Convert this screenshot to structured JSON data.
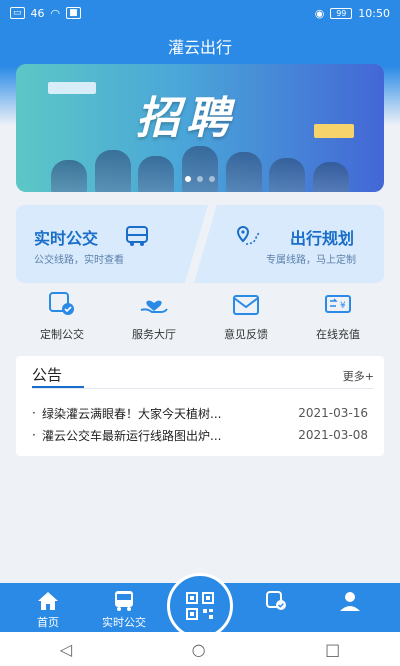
{
  "status": {
    "signal": "46",
    "time": "10:50",
    "battery": "99"
  },
  "app": {
    "title": "灌云出行"
  },
  "banner": {
    "title": "招聘"
  },
  "cards": {
    "bus": {
      "title": "实时公交",
      "subtitle": "公交线路，实时查看"
    },
    "plan": {
      "title": "出行规划",
      "subtitle": "专属线路，马上定制"
    }
  },
  "quick": [
    {
      "label": "定制公交"
    },
    {
      "label": "服务大厅"
    },
    {
      "label": "意见反馈"
    },
    {
      "label": "在线充值"
    }
  ],
  "notice": {
    "title": "公告",
    "more": "更多+",
    "items": [
      {
        "text": "绿染灌云满眼春！大家今天植树...",
        "date": "2021-03-16"
      },
      {
        "text": "灌云公交车最新运行线路图出炉...",
        "date": "2021-03-08"
      }
    ]
  },
  "tabs": {
    "home": "首页",
    "bus": "实时公交"
  },
  "colors": {
    "primary": "#2a8ae6",
    "accent": "#1a6ec9"
  }
}
